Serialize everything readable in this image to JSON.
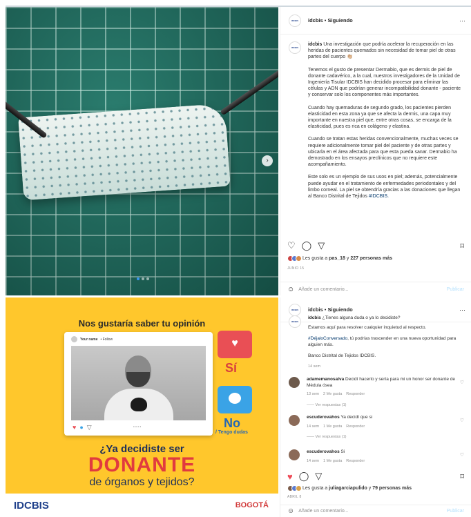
{
  "post1": {
    "header": {
      "username": "idcbis",
      "separator": "•",
      "follow": "Siguiendo",
      "more": "···",
      "avatar_text": "IDCBIS"
    },
    "caption": {
      "username": "idcbis",
      "p1": "Una investigación que podría acelerar la recuperación en las heridas de pacientes quemados sin necesidad de tomar piel de otras partes del cuerpo 👏🏼",
      "p2": "Tenemos el gusto de presentar Dermabio, que es dermis de piel de donante cadavérico, a la cual, nuestros investigadores de la Unidad de Ingeniería Tisular IDCBIS han decidido procesar para eliminar las células y ADN que podrían generar incompatibilidad donante - paciente y conservar solo los componentes más importantes.",
      "p3": "Cuando hay quemaduras de segundo grado, los pacientes pierden elasticidad en esta zona ya que se afecta la dermis, una capa muy importante en nuestra piel que, entre otras cosas, se encarga de la elasticidad, pues es rica en colágeno y elastina.",
      "p4": "Cuando se tratan estas heridas convencionalmente, muchas veces se requiere adicionalmente tomar piel del paciente y de otras partes y ubicarla en el área afectada para que esta pueda sanar. Dermabio ha demostrado en los ensayos preclínicos que no requiere este acompañamiento.",
      "p5": "Este solo es un ejemplo de sus usos en piel; además, potencialmente puede ayudar en el tratamiento de enfermedades periodontales y del limbo corneal. La piel se obtendría gracias a las donaciones que llegan al Banco Distrital de Tejidos",
      "hashtag": "#IDCBIS."
    },
    "likes": {
      "prefix": "Les gusta a",
      "user": "pas_18",
      "and": "y",
      "others": "227 personas más"
    },
    "date": "JUNIO 15",
    "comment_placeholder": "Añade un comentario...",
    "publish": "Publicar",
    "icons": {
      "like": "heart-outline-icon",
      "comment": "comment-icon",
      "share": "send-icon",
      "save": "bookmark-icon"
    }
  },
  "post2": {
    "header": {
      "username": "idcbis",
      "separator": "•",
      "follow": "Siguiendo",
      "more": "···",
      "avatar_text": "IDCBIS"
    },
    "graphic": {
      "title": "Nos gustaría saber tu opinión",
      "card_user": "Your name",
      "card_follow": "• Follow",
      "yes": "Sí",
      "no": "No",
      "no_sub": "/ Tengo dudas",
      "question": "¿Ya decidiste ser",
      "big": "DONANTE",
      "sub": "de órganos y tejidos?",
      "logo_left": "IDCBIS",
      "logo_right": "BOGOTÁ"
    },
    "caption": {
      "username": "idcbis",
      "line1": "¿Tienes alguna duda o ya lo decidiste?",
      "line2": "Estamos aquí para resolver cualquier inquietud al respecto.",
      "hashtag": "#DéjaloConversado",
      "line3": ", tú podrías trascender en una nueva oportunidad para alguien más.",
      "line4": "Banco Distrital de Tejidos IDCBIS.",
      "time": "14 sem"
    },
    "comments": [
      {
        "user": "adamemanosalva",
        "text": "Decidí hacerlo y sería para mi un honor ser donante de Médula ósea",
        "time": "13 sem",
        "likes": "2 Me gusta",
        "reply": "Responder",
        "view_replies": "—— Ver respuestas (1)"
      },
      {
        "user": "escuderovahos",
        "text": "Ya decidí que si",
        "time": "14 sem",
        "likes": "1 Me gusta",
        "reply": "Responder",
        "view_replies": "—— Ver respuestas (1)"
      },
      {
        "user": "escuderovahos",
        "text": "Si",
        "time": "14 sem",
        "likes": "1 Me gusta",
        "reply": "Responder",
        "view_replies": ""
      }
    ],
    "likes": {
      "prefix": "Les gusta a",
      "user": "juliagarciapulido",
      "and": "y",
      "others": "79 personas más"
    },
    "date": "ABRIL 8",
    "comment_placeholder": "Añade un comentario...",
    "publish": "Publicar",
    "icons": {
      "like": "heart-filled-icon",
      "comment": "comment-icon",
      "share": "send-icon",
      "save": "bookmark-icon"
    }
  },
  "colors": {
    "accent_blue": "#3897f0",
    "like_red": "#ed4956",
    "brand_yellow": "#ffc72c",
    "brand_red": "#e13b3f",
    "brand_navy": "#1e2f5a"
  }
}
